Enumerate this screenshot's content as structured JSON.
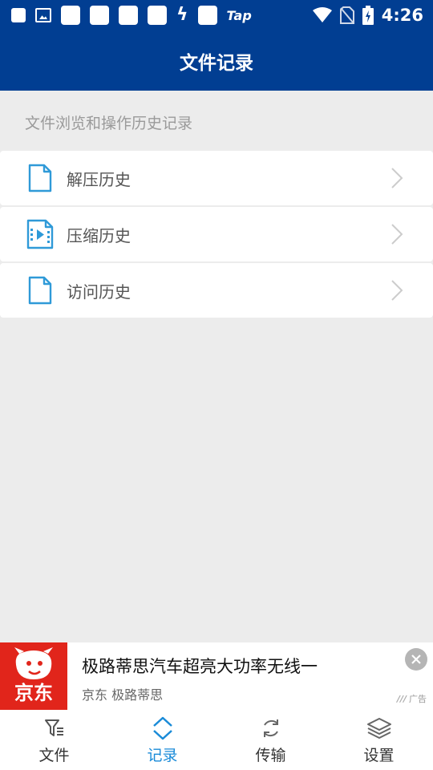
{
  "status_bar": {
    "time": "4:26",
    "app_text": "Tap"
  },
  "header": {
    "title": "文件记录"
  },
  "content": {
    "subtitle": "文件浏览和操作历史记录",
    "items": [
      {
        "label": "解压历史",
        "icon": "document-icon"
      },
      {
        "label": "压缩历史",
        "icon": "video-file-icon"
      },
      {
        "label": "访问历史",
        "icon": "document-icon"
      }
    ]
  },
  "ad": {
    "logo_text": "京东",
    "title": "极路蒂思汽车超亮大功率无线一",
    "subtitle": "京东 极路蒂思",
    "tag": "广告"
  },
  "bottom_nav": {
    "items": [
      {
        "label": "文件",
        "icon": "file-filter-icon",
        "active": false
      },
      {
        "label": "记录",
        "icon": "chevron-updown-icon",
        "active": true
      },
      {
        "label": "传输",
        "icon": "sync-icon",
        "active": false
      },
      {
        "label": "设置",
        "icon": "layers-icon",
        "active": false
      }
    ]
  },
  "colors": {
    "primary": "#013e92",
    "accent": "#1a8bd8",
    "icon_blue": "#2f9ad8",
    "background": "#ececec",
    "ad_red": "#e1251b"
  }
}
